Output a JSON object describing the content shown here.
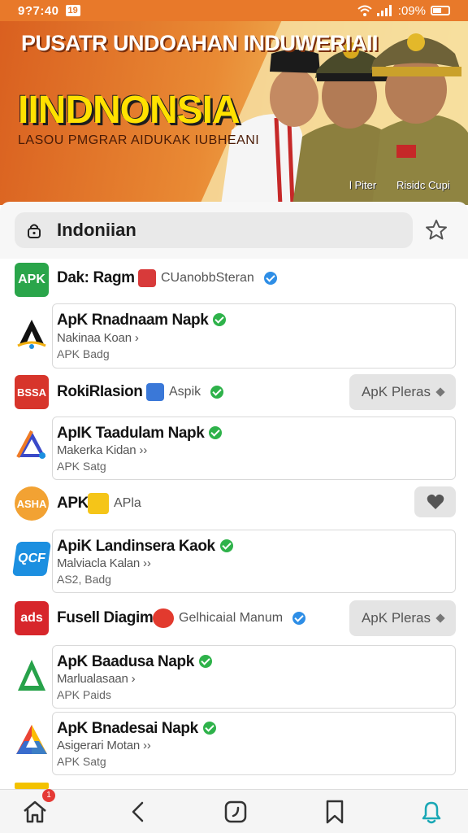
{
  "status_bar": {
    "time": "9?7:40",
    "badge": "19",
    "battery": ":09%"
  },
  "banner": {
    "title": "PUSATR UNDOAHAN INDUWERIAII",
    "big_text": "IINDNONSIA",
    "subtitle": "LASOU PMGRAR AIDUKAK IUBHEANI",
    "caption_left": "l Piter",
    "caption_right": "Risidc Cupi"
  },
  "search": {
    "value": "Indoniian"
  },
  "items": [
    {
      "logo": "APK",
      "logo_color": "#2aa54a",
      "name": "Dak: Ragm",
      "tag": "CUanobbSteran",
      "tag_verified": "blue"
    },
    {
      "logo": "A",
      "name": "ApK Rnadnaam Napk",
      "verified": true,
      "sub": "Nakinaa Koan",
      "meta": "APK Badg"
    },
    {
      "logo": "BSSA",
      "logo_color": "#d7352b",
      "name": "RokiRIasion",
      "tag": "Aspik",
      "button": "ApK Pleras"
    },
    {
      "logo": "A",
      "name": "ApIK Taadulam Napk",
      "verified": true,
      "sub": "Makerka Kidan",
      "meta": "APK Satg"
    },
    {
      "logo": "ASHA",
      "logo_color": "#f2a233",
      "name": "APK",
      "tag": "APla"
    },
    {
      "logo": "QCF",
      "logo_color": "#1c8fe0",
      "name": "ApiK Landinsera Kaok",
      "verified": true,
      "sub": "Malviacla Kalan",
      "meta": "AS2, Badg"
    },
    {
      "logo": "ads",
      "logo_color": "#d7262b",
      "name": "Fusell Diagim",
      "tag": "Gelhicaial Manum",
      "button": "ApK Pleras"
    },
    {
      "logo": "A",
      "name": "ApK Baadusa Napk",
      "verified": true,
      "sub": "Marlualasaan",
      "meta": "APK Paids"
    },
    {
      "logo": "A",
      "name": "ApK Bnadesai Napk",
      "verified": true,
      "sub": "Asigerari Motan",
      "meta": "APK Satg"
    }
  ],
  "bottom_nav": {
    "notification_count": "1",
    "accent": "#19a7b5"
  }
}
